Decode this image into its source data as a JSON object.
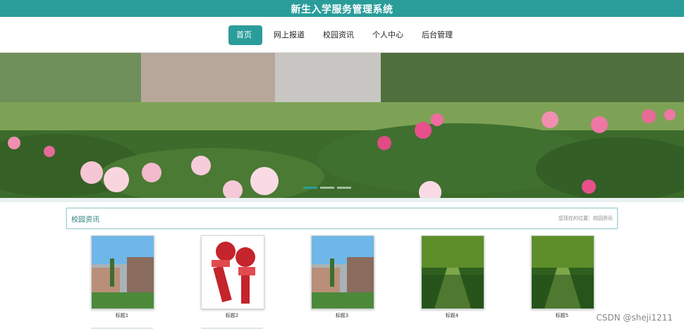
{
  "header": {
    "title": "新生入学服务管理系统"
  },
  "nav": {
    "items": [
      {
        "label": "首页",
        "active": true
      },
      {
        "label": "网上报道",
        "active": false
      },
      {
        "label": "校园资讯",
        "active": false
      },
      {
        "label": "个人中心",
        "active": false
      },
      {
        "label": "后台管理",
        "active": false
      }
    ]
  },
  "section": {
    "title": "校园资讯",
    "location": "您现在的位置：校园资讯"
  },
  "cards": [
    {
      "caption": "标题1",
      "image": "campus-building-photo"
    },
    {
      "caption": "标题2",
      "image": "news-live-microphones"
    },
    {
      "caption": "标题3",
      "image": "campus-building-photo"
    },
    {
      "caption": "标题4",
      "image": "tree-lined-path-photo"
    },
    {
      "caption": "标题5",
      "image": "tree-lined-path-photo"
    }
  ],
  "watermark": "CSDN @sheji1211",
  "colors": {
    "accent": "#2a9d9b"
  }
}
